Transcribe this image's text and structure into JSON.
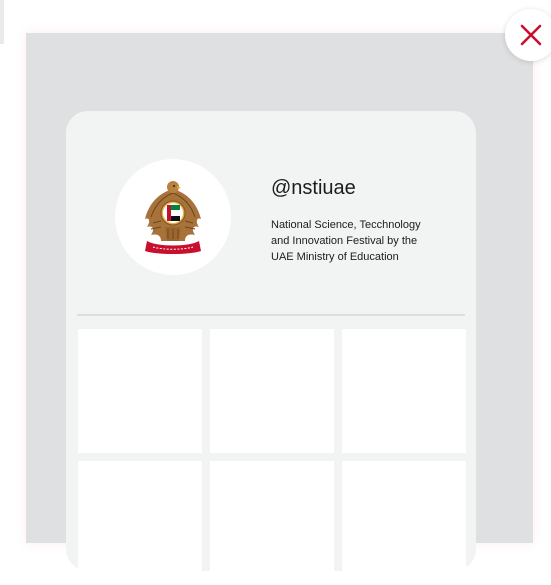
{
  "profile": {
    "handle": "@nstiuae",
    "bio": "National Science, Tecchnology and Innovation Festival by the UAE Ministry of Education",
    "avatar_icon": "uae-emblem-icon"
  },
  "grid": {
    "tile_count": 6
  },
  "close_icon": "close-icon",
  "colors": {
    "accent": "#c8102e",
    "backdrop": "#dfe0e2",
    "card": "#f2f3f3"
  }
}
